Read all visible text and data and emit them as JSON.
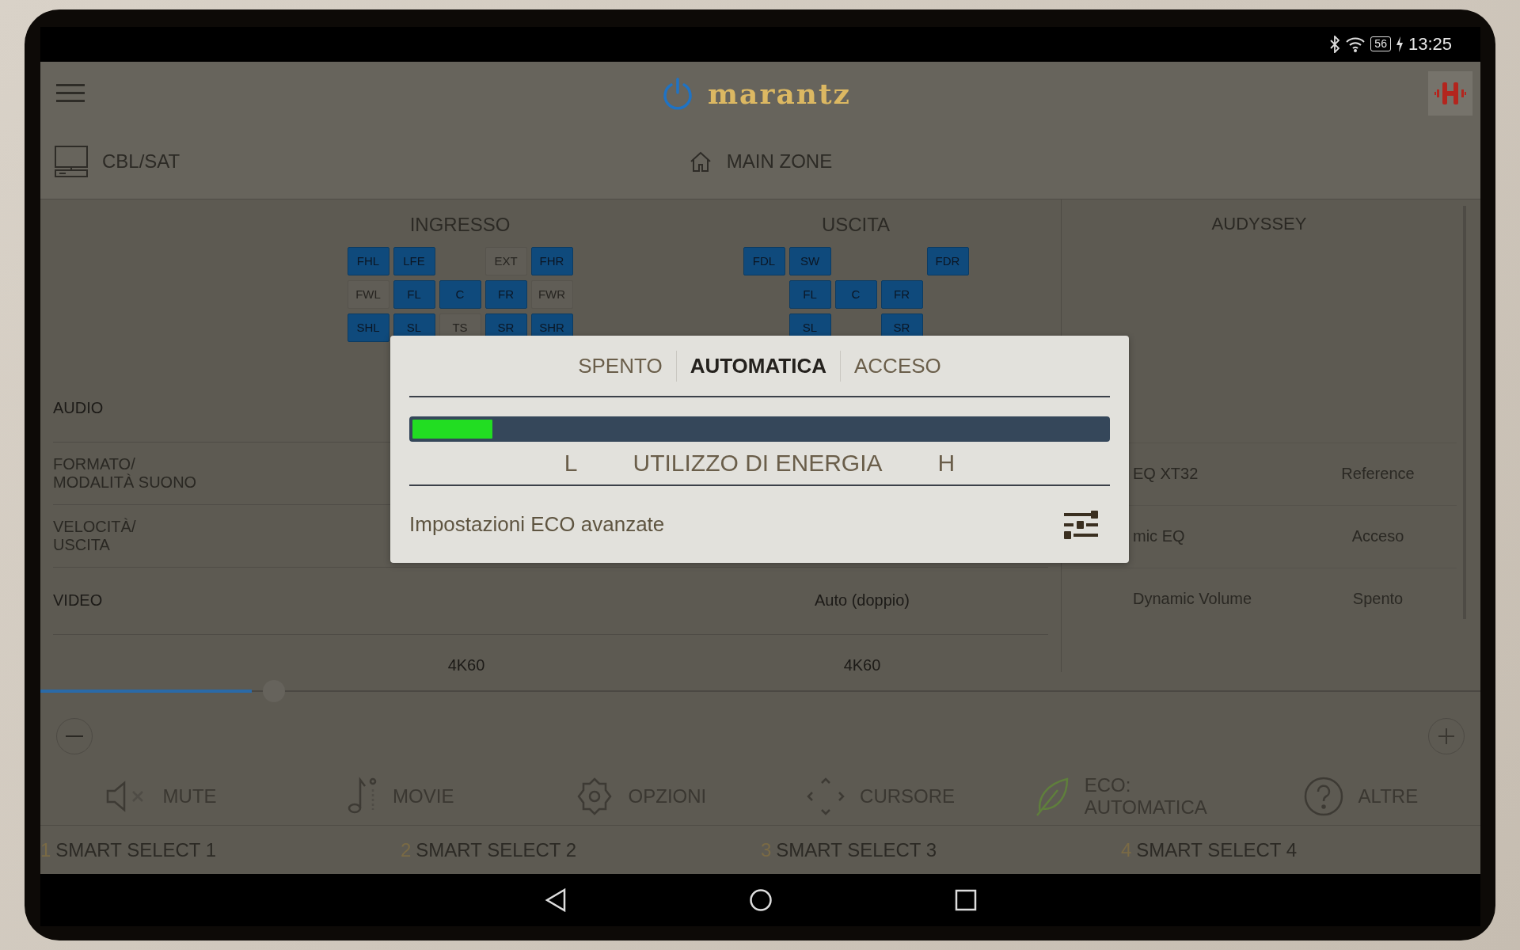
{
  "status_bar": {
    "battery": "56",
    "time": "13:25"
  },
  "header": {
    "logo": "marantz",
    "source": "CBL/SAT",
    "zone": "MAIN ZONE"
  },
  "channels": {
    "input": {
      "title": "INGRESSO",
      "rows": [
        [
          {
            "kind": "channel",
            "label": "FHL",
            "active": true
          },
          {
            "kind": "channel",
            "label": "LFE",
            "active": true
          },
          {
            "kind": "gap"
          },
          {
            "kind": "channel",
            "label": "EXT",
            "active": false
          },
          {
            "kind": "channel",
            "label": "FHR",
            "active": true
          }
        ],
        [
          {
            "kind": "channel",
            "label": "FWL",
            "active": false
          },
          {
            "kind": "channel",
            "label": "FL",
            "active": true
          },
          {
            "kind": "channel",
            "label": "C",
            "active": true
          },
          {
            "kind": "channel",
            "label": "FR",
            "active": true
          },
          {
            "kind": "channel",
            "label": "FWR",
            "active": false
          }
        ],
        [
          {
            "kind": "channel",
            "label": "SHL",
            "active": true
          },
          {
            "kind": "channel",
            "label": "SL",
            "active": true
          },
          {
            "kind": "channel",
            "label": "TS",
            "active": false
          },
          {
            "kind": "channel",
            "label": "SR",
            "active": true
          },
          {
            "kind": "channel",
            "label": "SHR",
            "active": true
          }
        ]
      ]
    },
    "output": {
      "title": "USCITA",
      "rows": [
        [
          {
            "kind": "channel",
            "label": "FDL",
            "active": true
          },
          {
            "kind": "channel",
            "label": "SW",
            "active": true
          },
          {
            "kind": "gap"
          },
          {
            "kind": "gap"
          },
          {
            "kind": "channel",
            "label": "FDR",
            "active": true
          }
        ],
        [
          {
            "kind": "gap"
          },
          {
            "kind": "channel",
            "label": "FL",
            "active": true
          },
          {
            "kind": "channel",
            "label": "C",
            "active": true
          },
          {
            "kind": "channel",
            "label": "FR",
            "active": true
          },
          {
            "kind": "gap"
          }
        ],
        [
          {
            "kind": "gap"
          },
          {
            "kind": "channel",
            "label": "SL",
            "active": true
          },
          {
            "kind": "gap"
          },
          {
            "kind": "channel",
            "label": "SR",
            "active": true
          },
          {
            "kind": "gap"
          }
        ]
      ]
    }
  },
  "info_table": {
    "rows": [
      {
        "kind": "section",
        "label": "AUDIO"
      },
      {
        "kind": "item",
        "label": "FORMATO/\nMODALITÀ SUONO"
      },
      {
        "kind": "item",
        "label": "VELOCITÀ/\nUSCITA"
      },
      {
        "kind": "section",
        "label": "VIDEO",
        "output": "Auto (doppio)"
      },
      {
        "kind": "item",
        "input": "4K60",
        "output": "4K60"
      }
    ]
  },
  "audyssey": {
    "title": "AUDYSSEY",
    "disabled": true,
    "rows": [
      {
        "label": "EQ XT32",
        "value": "Reference"
      },
      {
        "label": "mic EQ",
        "value": "Acceso"
      },
      {
        "label": "Dynamic Volume",
        "value": "Spento"
      }
    ]
  },
  "volume": {
    "level": 0.147
  },
  "actions": [
    {
      "kind": "mute",
      "label": "MUTE"
    },
    {
      "kind": "movie",
      "label": "MOVIE"
    },
    {
      "kind": "options",
      "label": "OPZIONI"
    },
    {
      "kind": "cursor",
      "label": "CURSORE"
    },
    {
      "kind": "eco",
      "label": "ECO:\nAUTOMATICA"
    },
    {
      "kind": "more",
      "label": "ALTRE"
    }
  ],
  "smart_select": [
    {
      "number": "1",
      "label": "SMART SELECT 1"
    },
    {
      "number": "2",
      "label": "SMART SELECT 2"
    },
    {
      "number": "3",
      "label": "SMART SELECT 3"
    },
    {
      "number": "4",
      "label": "SMART SELECT 4"
    }
  ],
  "eco_dialog": {
    "modes": [
      {
        "label": "SPENTO",
        "selected": false
      },
      {
        "label": "AUTOMATICA",
        "selected": true
      },
      {
        "label": "ACCESO",
        "selected": false
      }
    ],
    "level": 0.115,
    "low": "L",
    "caption": "UTILIZZO DI ENERGIA",
    "high": "H",
    "advanced": "Impostazioni ECO avanzate"
  }
}
